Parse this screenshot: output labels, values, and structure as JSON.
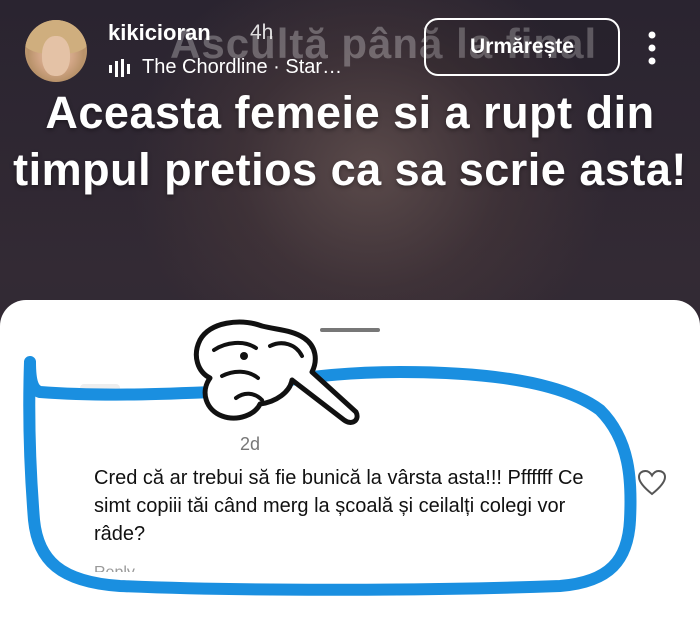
{
  "story": {
    "username": "kikicioran",
    "time_ago": "4h",
    "music": "The Chordline · Star…",
    "follow_label": "Urmărește",
    "headline": "Aceasta femeie si a rupt din timpul pretios ca sa scrie asta!",
    "background_text": "Ascultă până la final"
  },
  "comment": {
    "time_ago": "2d",
    "text": "Cred că ar trebui  să  fie bunică la vârsta asta!!! Pffffff  Ce simt copiii tăi când merg la școală și ceilalți  colegi vor râde?",
    "reply_label": "Reply"
  },
  "icons": [
    "music-bars-icon",
    "more-options-icon",
    "heart-icon",
    "pointing-hand-icon"
  ],
  "colors": {
    "annotation_blue": "#1a8fe0",
    "sheet_bg": "#ffffff"
  }
}
